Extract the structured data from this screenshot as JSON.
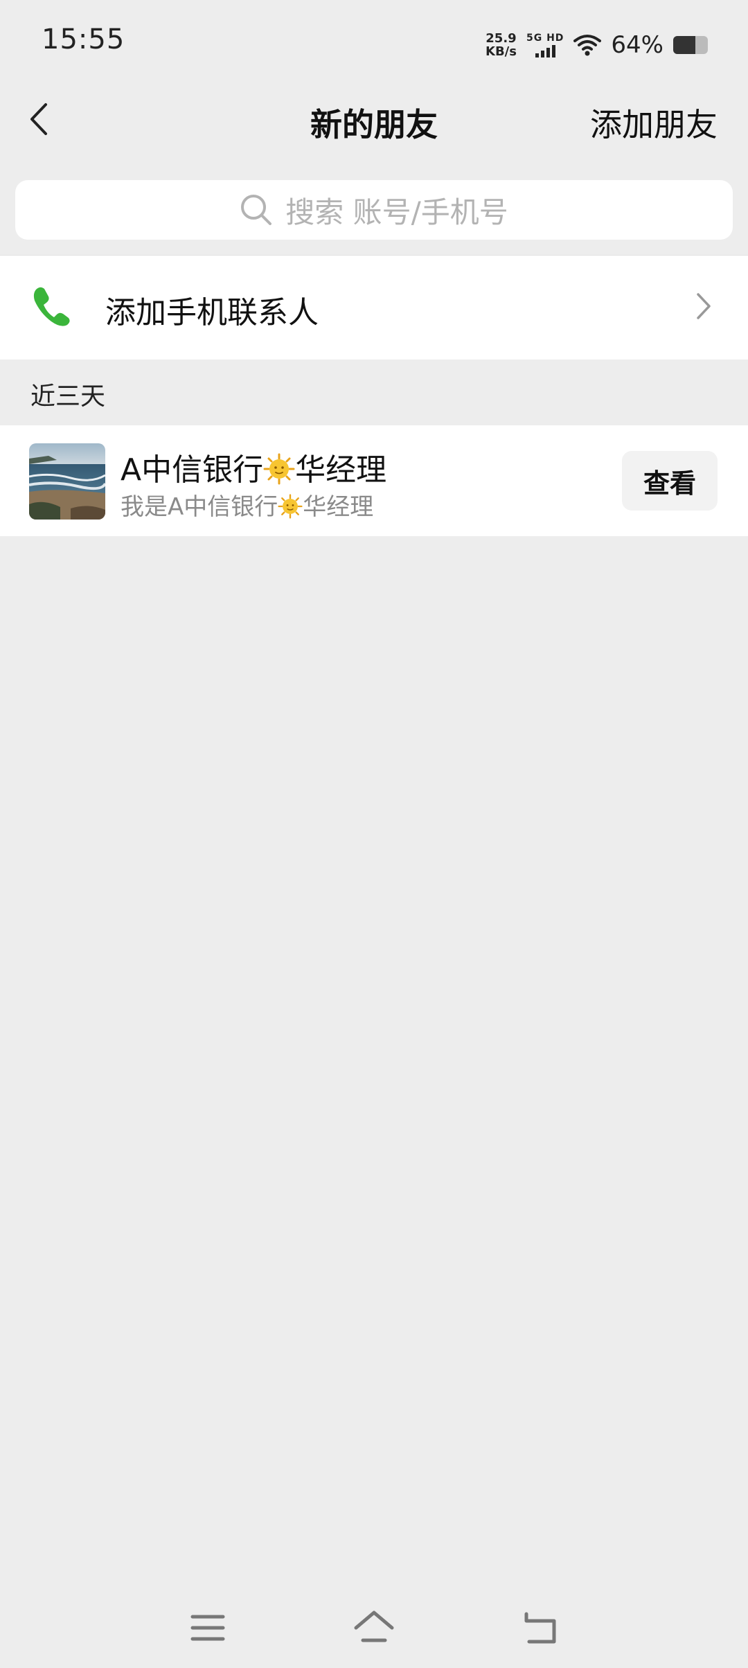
{
  "status_bar": {
    "time": "15:55",
    "net_speed_value": "25.9",
    "net_speed_unit": "KB/s",
    "signal_label": "5G HD",
    "battery_percent": "64%",
    "battery_level": 0.64
  },
  "nav": {
    "title": "新的朋友",
    "action_label": "添加朋友"
  },
  "search": {
    "placeholder": "搜索 账号/手机号"
  },
  "phone_contacts": {
    "label": "添加手机联系人"
  },
  "section": {
    "header": "近三天"
  },
  "requests": [
    {
      "name_prefix": "A中信银行",
      "name_suffix": "华经理",
      "message_prefix": "我是A中信银行",
      "message_suffix": "华经理",
      "emoji": "sun-face-icon",
      "button_label": "查看"
    }
  ],
  "colors": {
    "background": "#ededed",
    "accent_green": "#3bb53b",
    "placeholder_gray": "#b3b3b3"
  }
}
